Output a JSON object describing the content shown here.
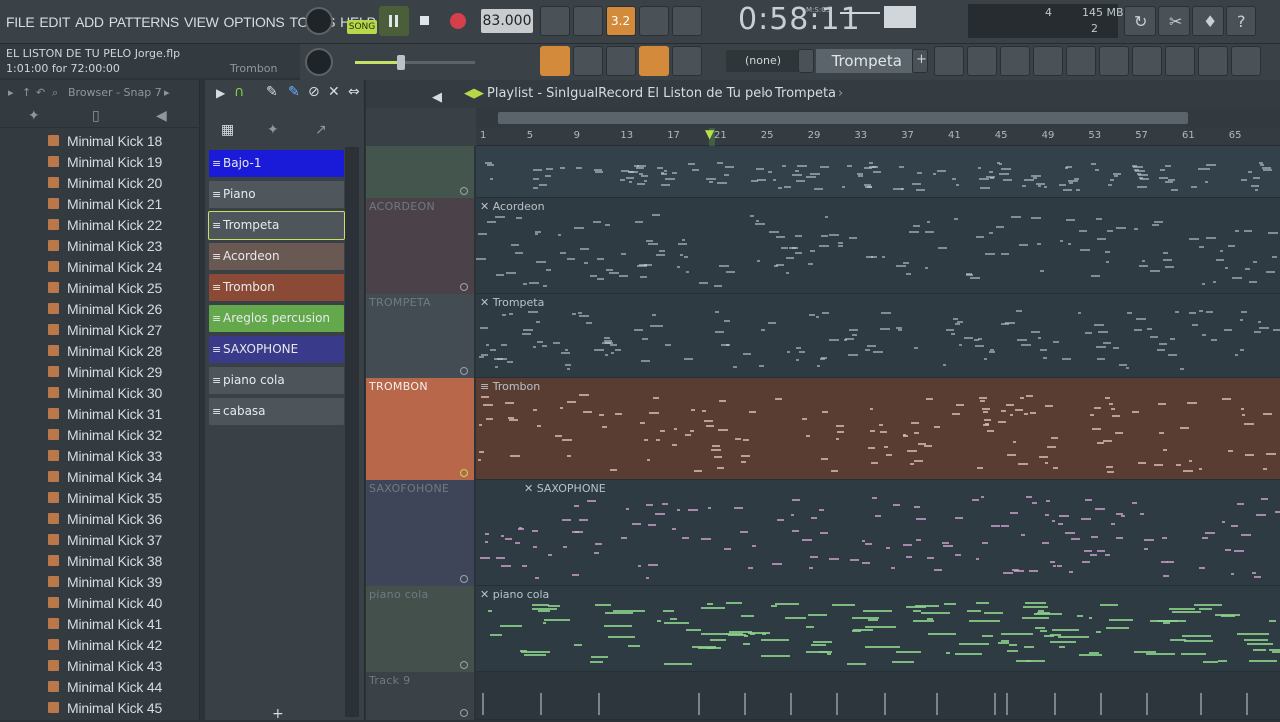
{
  "menu": [
    "FILE",
    "EDIT",
    "ADD",
    "PATTERNS",
    "VIEW",
    "OPTIONS",
    "TOOLS",
    "HELP"
  ],
  "transport": {
    "mode_label": "SONG",
    "tempo": "83.000",
    "time": "0:58:11",
    "time_unit": "M:S:CS",
    "snap_value": "3.2"
  },
  "status": {
    "cpu_top": "4",
    "cpu_bottom": "2",
    "memory": "145 MB"
  },
  "song": {
    "title": "EL LISTON DE TU PELO Jorge.flp",
    "time_info": "1:01:00 for 72:00:00",
    "hint": "Trombon"
  },
  "pattern": {
    "selector": "(none)",
    "current": "Trompeta"
  },
  "browser": {
    "title": "Browser - Snap 7",
    "items": [
      "Minimal Kick 18",
      "Minimal Kick 19",
      "Minimal Kick 20",
      "Minimal Kick 21",
      "Minimal Kick 22",
      "Minimal Kick 23",
      "Minimal Kick 24",
      "Minimal Kick 25",
      "Minimal Kick 26",
      "Minimal Kick 27",
      "Minimal Kick 28",
      "Minimal Kick 29",
      "Minimal Kick 30",
      "Minimal Kick 31",
      "Minimal Kick 32",
      "Minimal Kick 33",
      "Minimal Kick 34",
      "Minimal Kick 35",
      "Minimal Kick 36",
      "Minimal Kick 37",
      "Minimal Kick 38",
      "Minimal Kick 39",
      "Minimal Kick 40",
      "Minimal Kick 41",
      "Minimal Kick 42",
      "Minimal Kick 43",
      "Minimal Kick 44",
      "Minimal Kick 45"
    ]
  },
  "patterns": [
    {
      "label": "Bajo-1",
      "color": "#1a1ad9"
    },
    {
      "label": "Piano",
      "color": "#4f575d"
    },
    {
      "label": "Trompeta",
      "color": "#4e565b"
    },
    {
      "label": "Acordeon",
      "color": "#6a5852"
    },
    {
      "label": "Trombon",
      "color": "#8a4a36"
    },
    {
      "label": "Areglos percusion",
      "color": "#64a84c"
    },
    {
      "label": "SAXOPHONE",
      "color": "#3a3a8a"
    },
    {
      "label": "piano cola",
      "color": "#4d555b"
    },
    {
      "label": "cabasa",
      "color": "#4d555b"
    }
  ],
  "playlist": {
    "title": "Playlist - SinIgualRecord El Liston de Tu pelo",
    "breadcrumb": "Trompeta",
    "ruler": [
      "1",
      "5",
      "9",
      "13",
      "17",
      "21",
      "25",
      "29",
      "33",
      "37",
      "41",
      "45",
      "49",
      "53",
      "57",
      "61",
      "65"
    ],
    "tracks": [
      {
        "name": "",
        "clip": "",
        "head_color": "#44554d",
        "lane_color": "#33424a"
      },
      {
        "name": "ACORDEON",
        "clip": "Acordeon",
        "head_color": "#4a4248",
        "lane_color": "#2f3b42"
      },
      {
        "name": "TROMPETA",
        "clip": "Trompeta",
        "head_color": "#434c52",
        "lane_color": "#2f3b42"
      },
      {
        "name": "TROMBON",
        "clip": "Trombon",
        "head_color": "#b8674a",
        "lane_color": "#5a3d32"
      },
      {
        "name": "SAXOFOHONE",
        "clip": "SAXOPHONE",
        "head_color": "#3f4558",
        "lane_color": "#2f3b42"
      },
      {
        "name": "piano cola",
        "clip": "piano cola",
        "head_color": "#43504c",
        "lane_color": "#2f3b42"
      },
      {
        "name": "Track 9",
        "clip": "",
        "head_color": "#3a4247",
        "lane_color": "#2c363c"
      }
    ]
  }
}
